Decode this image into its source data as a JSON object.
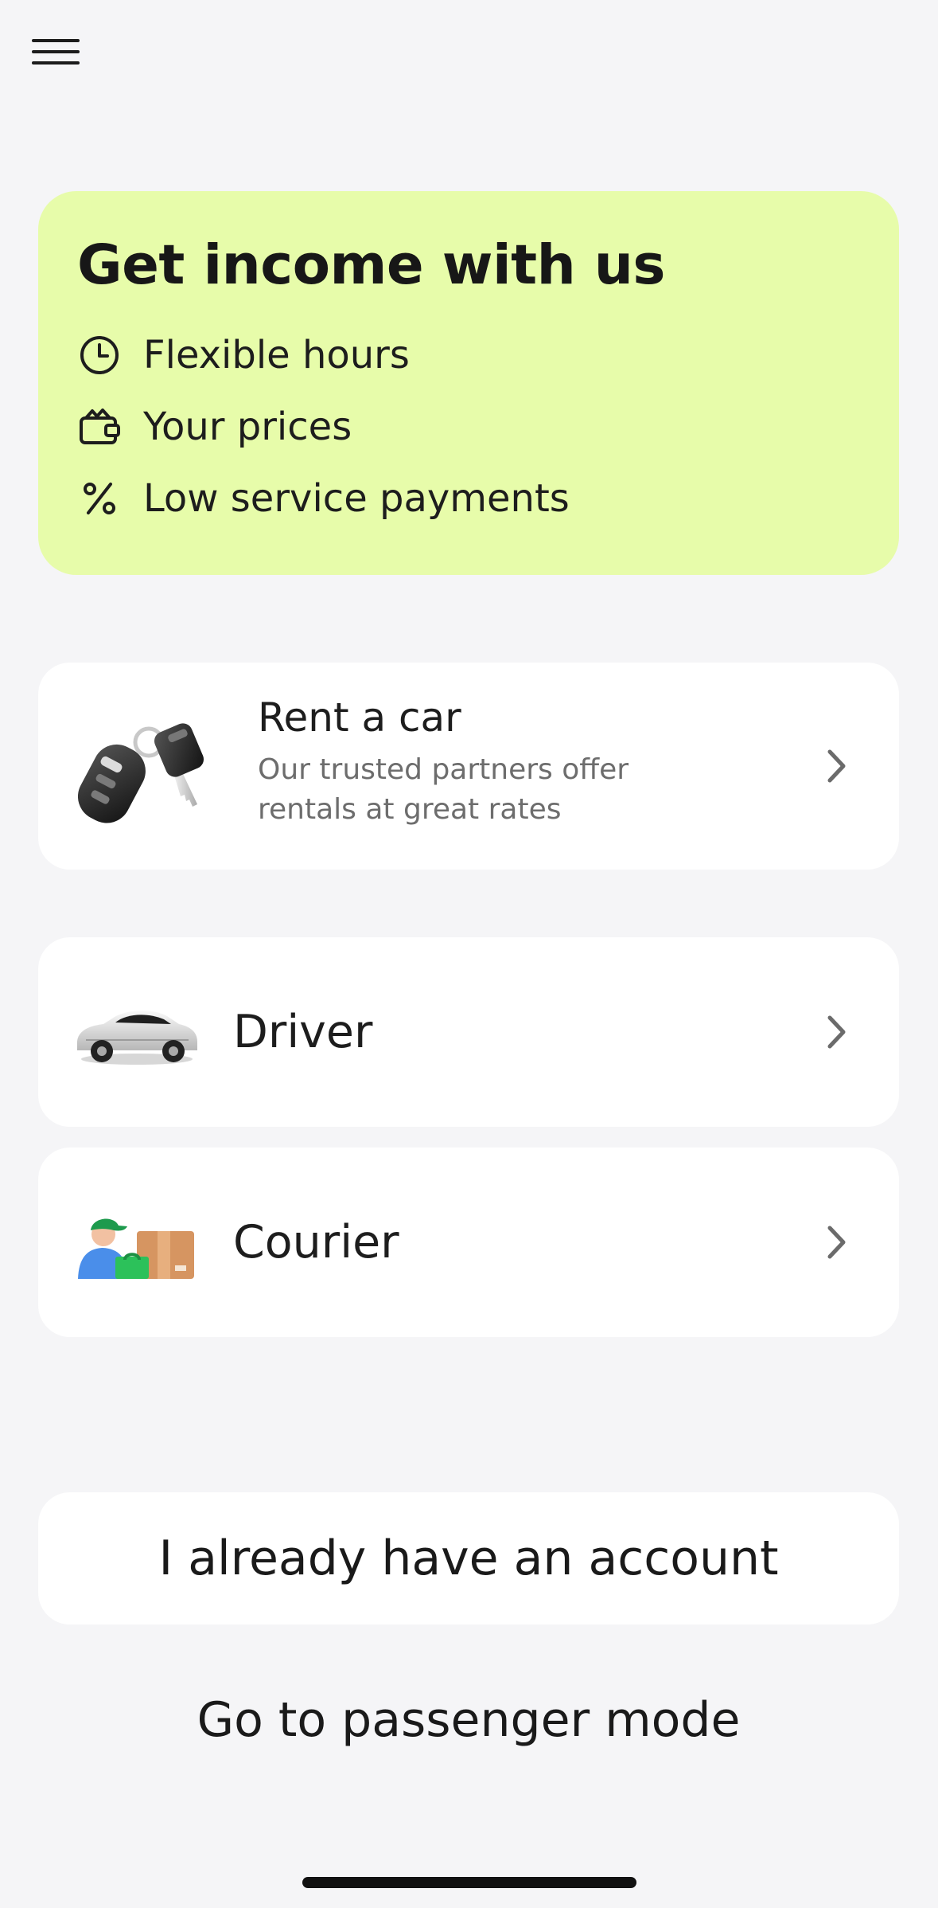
{
  "header": {
    "menu_icon": "hamburger-menu-icon"
  },
  "promo": {
    "title": "Get income with us",
    "items": [
      {
        "icon": "clock-icon",
        "label": "Flexible hours"
      },
      {
        "icon": "wallet-icon",
        "label": "Your prices"
      },
      {
        "icon": "percent-icon",
        "label": "Low service payments"
      }
    ],
    "background_color": "#e7fcaa"
  },
  "options": {
    "rent": {
      "title": "Rent a car",
      "subtitle": "Our trusted partners offer rentals at great rates",
      "image": "car-keys-image"
    },
    "driver": {
      "label": "Driver",
      "image": "car-image"
    },
    "courier": {
      "label": "Courier",
      "image": "courier-image"
    }
  },
  "actions": {
    "account_label": "I already have an account",
    "passenger_label": "Go to passenger mode"
  }
}
